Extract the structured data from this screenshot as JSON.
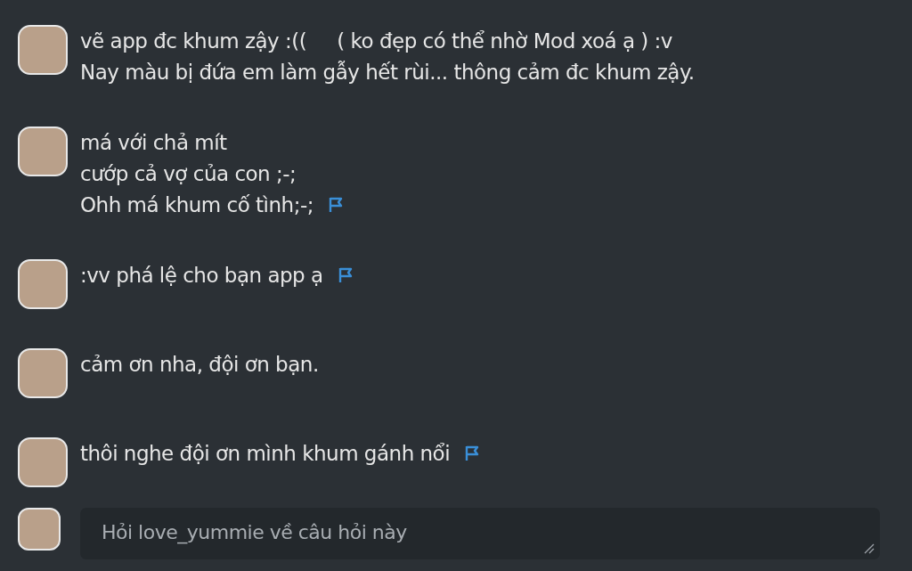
{
  "messages": [
    {
      "lines": [
        "vẽ app đc khum zậy :((     ( ko đẹp có thể nhờ Mod xoá ạ ) :v",
        "Nay màu bị đứa em làm gẫy hết rùi... thông cảm đc khum zậy."
      ],
      "flagged": false
    },
    {
      "lines": [
        "má với chả mít",
        "cướp cả vợ của con ;-;",
        "Ohh má khum cố tình;-;"
      ],
      "flagged": true
    },
    {
      "lines": [
        ":vv phá lệ cho bạn app ạ"
      ],
      "flagged": true
    },
    {
      "lines": [
        "cảm ơn nha, đội ơn bạn."
      ],
      "flagged": false
    },
    {
      "lines": [
        "thôi nghe đội ơn mình khum gánh nổi"
      ],
      "flagged": true
    }
  ],
  "reply": {
    "placeholder": "Hỏi love_yummie về câu hỏi này"
  }
}
